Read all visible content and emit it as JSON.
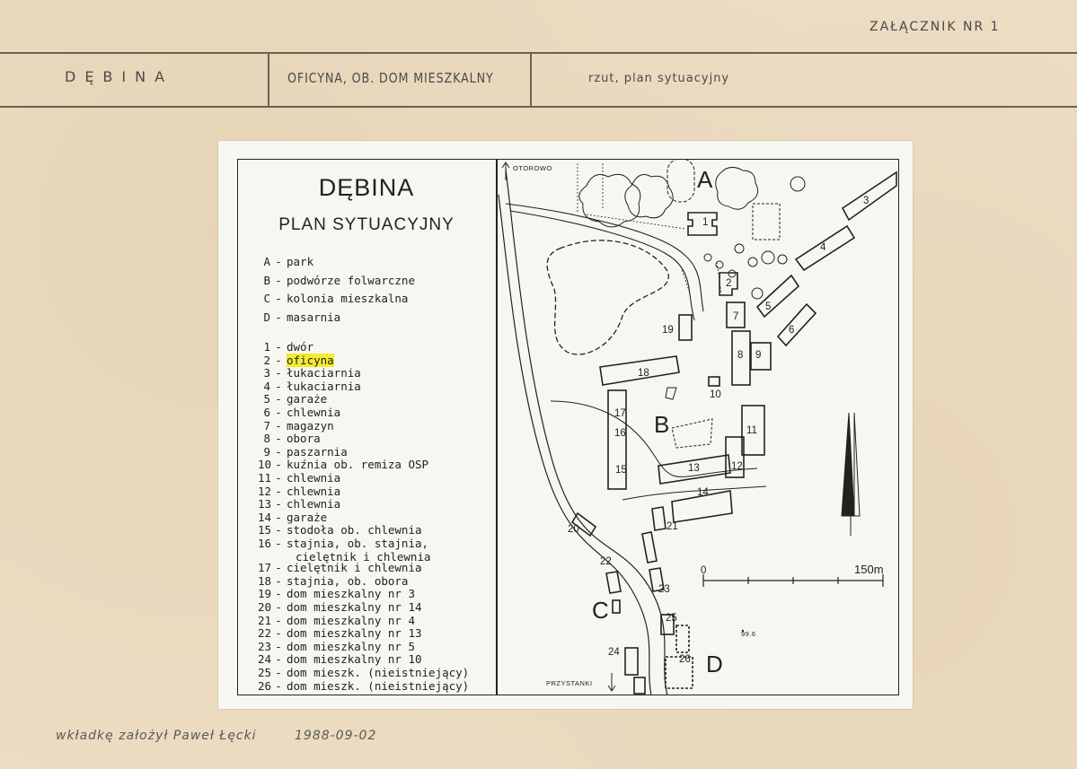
{
  "card": {
    "attachment": "ZAŁĄCZNIK NR 1",
    "fields": [
      "DĘBINA",
      "OFICYNA, OB. DOM MIESZKALNY",
      "rzut, plan sytuacyjny"
    ],
    "footer_note": "wkładkę założył Paweł Łęcki",
    "footer_date": "1988-09-02"
  },
  "legend": {
    "title": "DĘBINA",
    "subtitle": "PLAN SYTUACYJNY",
    "zones": [
      {
        "key": "A",
        "label": "park"
      },
      {
        "key": "B",
        "label": "podwórze folwarczne"
      },
      {
        "key": "C",
        "label": "kolonia mieszkalna"
      },
      {
        "key": "D",
        "label": "masarnia"
      }
    ],
    "items": [
      {
        "key": "1",
        "label": "dwór"
      },
      {
        "key": "2",
        "label": "oficyna",
        "highlight": true
      },
      {
        "key": "3",
        "label": "łukaciarnia"
      },
      {
        "key": "4",
        "label": "łukaciarnia"
      },
      {
        "key": "5",
        "label": "garaże"
      },
      {
        "key": "6",
        "label": "chlewnia"
      },
      {
        "key": "7",
        "label": "magazyn"
      },
      {
        "key": "8",
        "label": "obora"
      },
      {
        "key": "9",
        "label": "paszarnia"
      },
      {
        "key": "10",
        "label": "kuźnia ob. remiza OSP"
      },
      {
        "key": "11",
        "label": "chlewnia"
      },
      {
        "key": "12",
        "label": "chlewnia"
      },
      {
        "key": "13",
        "label": "chlewnia"
      },
      {
        "key": "14",
        "label": "garaże"
      },
      {
        "key": "15",
        "label": "stodoła ob. chlewnia"
      },
      {
        "key": "16",
        "label": "stajnia, ob. stajnia,",
        "cont": "cielętnik i chlewnia"
      },
      {
        "key": "17",
        "label": "cielętnik i chlewnia"
      },
      {
        "key": "18",
        "label": "stajnia, ob. obora"
      },
      {
        "key": "19",
        "label": "dom mieszkalny nr 3"
      },
      {
        "key": "20",
        "label": "dom mieszkalny nr 14"
      },
      {
        "key": "21",
        "label": "dom mieszkalny nr 4"
      },
      {
        "key": "22",
        "label": "dom mieszkalny nr 13"
      },
      {
        "key": "23",
        "label": "dom mieszkalny nr 5"
      },
      {
        "key": "24",
        "label": "dom mieszkalny nr 10"
      },
      {
        "key": "25",
        "label": "dom mieszk. (nieistniejący)"
      },
      {
        "key": "26",
        "label": "dom mieszk. (nieistniejący)"
      }
    ]
  },
  "map": {
    "road_north": "OTOROWO",
    "road_south": "PRZYSTANKI",
    "elevation": "99.6",
    "scale_start": "0",
    "scale_end": "150m",
    "zone_labels": [
      "A",
      "B",
      "C",
      "D"
    ],
    "building_numbers": [
      "1",
      "2",
      "3",
      "4",
      "5",
      "6",
      "7",
      "8",
      "9",
      "10",
      "11",
      "12",
      "13",
      "14",
      "15",
      "16",
      "17",
      "18",
      "19",
      "20",
      "21",
      "22",
      "23",
      "24",
      "25",
      "26"
    ]
  }
}
